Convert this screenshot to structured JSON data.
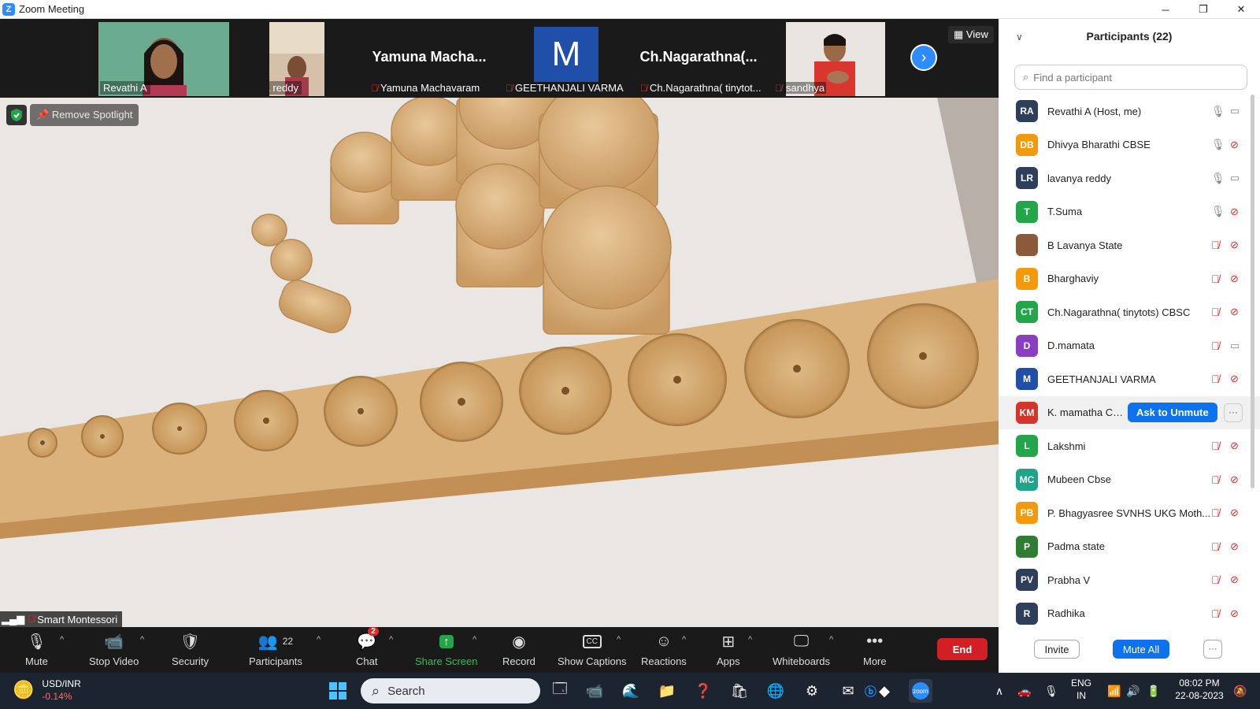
{
  "window": {
    "title": "Zoom Meeting",
    "min": "─",
    "max": "❐",
    "close": "✕"
  },
  "video_strip": {
    "tiles": [
      {
        "name": "Revathi A",
        "muted": false
      },
      {
        "name": "lavanya reddy",
        "muted": false
      },
      {
        "big": "Yamuna  Macha...",
        "name": "Yamuna Machavaram",
        "muted": true
      },
      {
        "big": "M",
        "name": "GEETHANJALI VARMA",
        "muted": true
      },
      {
        "big": "Ch.Nagarathna(...",
        "name": "Ch.Nagarathna( tinytot...",
        "muted": true
      },
      {
        "name": "sandhya",
        "muted": true
      }
    ],
    "view_label": "View"
  },
  "main_video": {
    "spotlight_label": "Remove Spotlight",
    "speaker_name": "Smart Montessori"
  },
  "toolbar": {
    "mute": "Mute",
    "stop_video": "Stop Video",
    "security": "Security",
    "participants": "Participants",
    "participants_count": "22",
    "chat": "Chat",
    "chat_badge": "2",
    "share_screen": "Share Screen",
    "record": "Record",
    "show_captions": "Show Captions",
    "reactions": "Reactions",
    "apps": "Apps",
    "whiteboards": "Whiteboards",
    "more": "More",
    "end": "End"
  },
  "participants_panel": {
    "title": "Participants (22)",
    "search_placeholder": "Find a participant",
    "list": [
      {
        "initials": "RA",
        "name": "Revathi A (Host, me)",
        "color": "#2e3f5c",
        "mic": "on",
        "cam": "on"
      },
      {
        "initials": "DB",
        "name": "Dhivya Bharathi CBSE",
        "color": "#f29a0c",
        "mic": "on",
        "cam": "off"
      },
      {
        "initials": "LR",
        "name": "lavanya reddy",
        "color": "#2e3f5c",
        "mic": "on",
        "cam": "on"
      },
      {
        "initials": "T",
        "name": "T.Suma",
        "color": "#23a54a",
        "mic": "on",
        "cam": "off"
      },
      {
        "initials": "",
        "name": "B Lavanya State",
        "color": "#8a5a3a",
        "mic": "off",
        "cam": "off"
      },
      {
        "initials": "B",
        "name": "Bharghaviy",
        "color": "#f29a0c",
        "mic": "off",
        "cam": "off"
      },
      {
        "initials": "CT",
        "name": "Ch.Nagarathna( tinytots) CBSC",
        "color": "#23a54a",
        "mic": "off",
        "cam": "off"
      },
      {
        "initials": "D",
        "name": "D.mamata",
        "color": "#8a3ec2",
        "mic": "off",
        "cam": "on"
      },
      {
        "initials": "M",
        "name": "GEETHANJALI VARMA",
        "color": "#1f4fa8",
        "mic": "off",
        "cam": "off"
      },
      {
        "initials": "KM",
        "name": "K. mamatha CB...",
        "color": "#d2352c",
        "mic": "",
        "cam": "",
        "ask": "Ask to Unmute",
        "more": "···"
      },
      {
        "initials": "L",
        "name": "Lakshmi",
        "color": "#23a54a",
        "mic": "off",
        "cam": "off"
      },
      {
        "initials": "MC",
        "name": "Mubeen Cbse",
        "color": "#1fa48a",
        "mic": "off",
        "cam": "off"
      },
      {
        "initials": "PB",
        "name": "P. Bhagyasree  SVNHS UKG Moth...",
        "color": "#f29a0c",
        "mic": "off",
        "cam": "off"
      },
      {
        "initials": "P",
        "name": "Padma state",
        "color": "#2e7d32",
        "mic": "off",
        "cam": "off"
      },
      {
        "initials": "PV",
        "name": "Prabha V",
        "color": "#2e3f5c",
        "mic": "off",
        "cam": "off"
      },
      {
        "initials": "R",
        "name": "Radhika",
        "color": "#2e3f5c",
        "mic": "off",
        "cam": "off"
      }
    ],
    "invite": "Invite",
    "mute_all": "Mute All",
    "more": "···"
  },
  "taskbar": {
    "ticker_name": "USD/INR",
    "ticker_change": "-0.14%",
    "search_label": "Search",
    "lang1": "ENG",
    "lang2": "IN",
    "time": "08:02 PM",
    "date": "22-08-2023"
  }
}
